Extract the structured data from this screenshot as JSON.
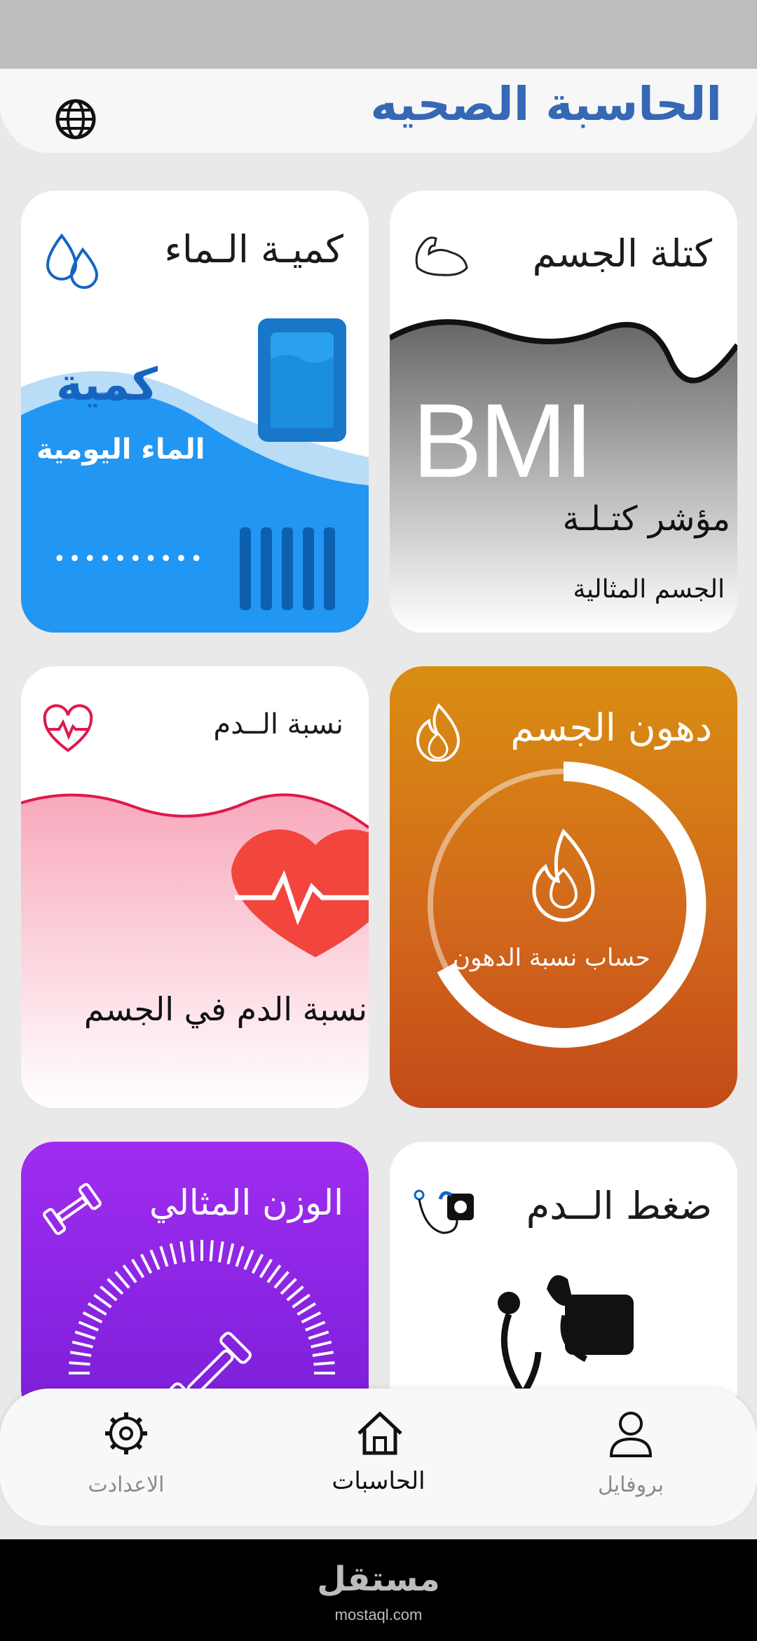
{
  "header": {
    "title": "الحاسبة الصحيه",
    "globe_icon": "globe-icon"
  },
  "cards": {
    "water": {
      "title": "كميـة الـماء",
      "sub1": "كمية",
      "sub2": "الماء اليومية",
      "dots": "••••••••••",
      "icon": "water-drops-icon"
    },
    "bmi": {
      "title": "كتلة الجسم",
      "big": "BMI",
      "sub1": "مؤشر كتـلـة",
      "sub2": "الجسم المثالية",
      "icon": "muscle-arm-icon"
    },
    "blood": {
      "title": "نسبة الــدم",
      "sub": "نسبة الدم في الجسم",
      "icon": "heart-pulse-icon"
    },
    "fat": {
      "title": "دهون الجسم",
      "sub": "حساب نسبة الدهون",
      "icon": "flame-icon"
    },
    "weight": {
      "title": "الوزن المثالي",
      "icon": "dumbbell-icon"
    },
    "pressure": {
      "title": "ضغط الــدم",
      "icon": "blood-pressure-monitor-icon"
    }
  },
  "nav": {
    "settings": "الاعدادت",
    "calculators": "الحاسبات",
    "profile": "بروفايل"
  },
  "watermark": {
    "logo": "مستقل",
    "url": "mostaql.com"
  },
  "colors": {
    "title_blue": "#3568b5",
    "water_blue": "#2196f3",
    "fat_orange": "#d98e11",
    "weight_purple": "#8e24e8"
  }
}
